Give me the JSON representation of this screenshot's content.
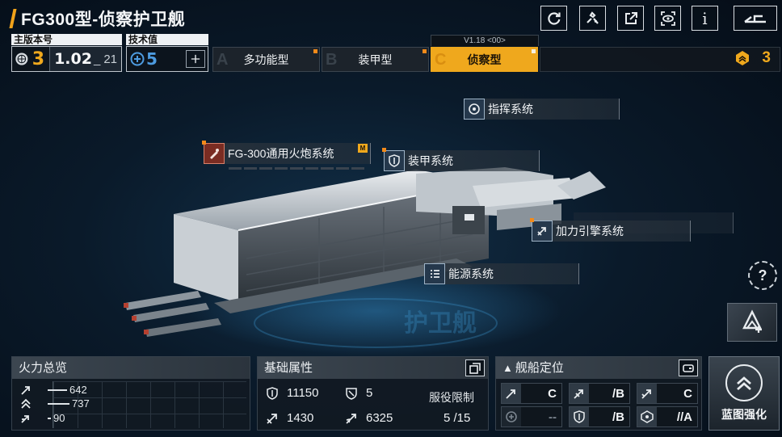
{
  "title": "FG300型-侦察护卫舰",
  "top_buttons": [
    {
      "name": "refresh-icon"
    },
    {
      "name": "tools-icon"
    },
    {
      "name": "share-icon"
    },
    {
      "name": "view-icon"
    },
    {
      "name": "info-icon",
      "label": "i"
    }
  ],
  "version": {
    "header": "主版本号",
    "major": "3",
    "minor": "1.02",
    "patch": "21"
  },
  "tech": {
    "header": "技术值",
    "value": "5"
  },
  "type_tabs": [
    {
      "letter": "A",
      "label": "多功能型"
    },
    {
      "letter": "B",
      "label": "装甲型"
    },
    {
      "letter": "C",
      "label": "侦察型",
      "selected": true
    }
  ],
  "version_tag": "V1.18 <00>",
  "points": "3",
  "systems": {
    "command": "指挥系统",
    "gun": "FG-300通用火炮系统",
    "gun_badge": "M",
    "armor": "装甲系统",
    "engine": "加力引擎系统",
    "power": "能源系统"
  },
  "help_label": "?",
  "firepower": {
    "title": "火力总览",
    "rows": [
      {
        "icon": "anti-ship-icon",
        "value": "642"
      },
      {
        "icon": "anti-air-icon",
        "value": "737"
      },
      {
        "icon": "siege-icon",
        "value": "90"
      }
    ]
  },
  "attributes": {
    "title": "基础属性",
    "hp": "11150",
    "armor": "5",
    "speed": "1430",
    "warp": "6325",
    "service_label": "服役限制",
    "service_value": "5 /15"
  },
  "position": {
    "title": "舰船定位",
    "cells": [
      {
        "icon": "anti-ship-icon",
        "value": "C"
      },
      {
        "icon": "anti-air-icon",
        "value": "/B"
      },
      {
        "icon": "siege-icon",
        "value": "C"
      },
      {
        "icon": "support-icon",
        "value": "--",
        "dim": true
      },
      {
        "icon": "shield-icon",
        "value": "/B"
      },
      {
        "icon": "stealth-icon",
        "value": "//A"
      }
    ]
  },
  "blueprint_label": "蓝图强化",
  "colors": {
    "accent": "#efa81d",
    "background": "#0a1a2a"
  }
}
